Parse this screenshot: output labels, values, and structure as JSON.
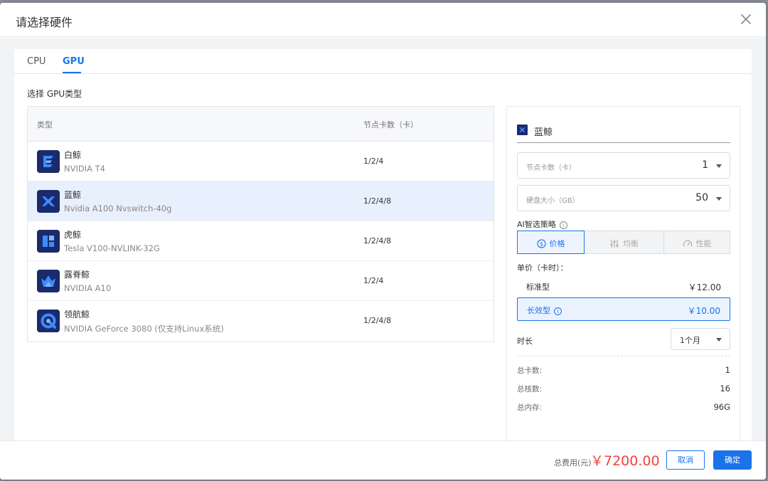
{
  "dialog": {
    "title": "请选择硬件",
    "tabs": [
      {
        "label": "CPU",
        "active": false
      },
      {
        "label": "GPU",
        "active": true
      }
    ],
    "section_title": "选择 GPU类型"
  },
  "gpu_table": {
    "headers": {
      "type": "类型",
      "cards": "节点卡数（卡）"
    },
    "rows": [
      {
        "name": "白鲸",
        "model": "NVIDIA T4",
        "cards": "1/2/4",
        "icon": "beluga-white-icon",
        "selected": false
      },
      {
        "name": "蓝鲸",
        "model": "Nvidia A100 Nvswitch-40g",
        "cards": "1/2/4/8",
        "icon": "blue-whale-icon",
        "selected": true
      },
      {
        "name": "虎鲸",
        "model": "Tesla V100-NVLINK-32G",
        "cards": "1/2/4/8",
        "icon": "orca-icon",
        "selected": false
      },
      {
        "name": "露脊鲸",
        "model": "NVIDIA A10",
        "cards": "1/2/4",
        "icon": "right-whale-icon",
        "selected": false
      },
      {
        "name": "领航鲸",
        "model": "NVIDIA GeForce 3080 (仅支持Linux系统)",
        "cards": "1/2/4/8",
        "icon": "pilot-whale-icon",
        "selected": false
      }
    ]
  },
  "config_panel": {
    "selected_name": "蓝鲸",
    "node_cards": {
      "label": "节点卡数（卡）",
      "value": "1"
    },
    "disk_size": {
      "label": "硬盘大小（GB）",
      "value": "50"
    },
    "ai_strategy": {
      "label": "AI智选策略",
      "options": [
        {
          "label": "价格",
          "icon": "dollar-circle-icon",
          "active": true
        },
        {
          "label": "均衡",
          "icon": "sliders-icon",
          "active": false
        },
        {
          "label": "性能",
          "icon": "speedometer-icon",
          "active": false
        }
      ]
    },
    "unit_price_label": "单价（卡时）：",
    "prices": [
      {
        "name": "标准型",
        "value": "￥12.00",
        "selected": false
      },
      {
        "name": "长效型",
        "value": "￥10.00",
        "selected": true
      }
    ],
    "duration": {
      "label": "时长",
      "value": "1个月"
    },
    "summary": [
      {
        "key": "总卡数:",
        "value": "1"
      },
      {
        "key": "总核数:",
        "value": "16"
      },
      {
        "key": "总内存:",
        "value": "96G"
      }
    ]
  },
  "footer": {
    "total_label": "总费用(元)",
    "total_value": "￥7200.00",
    "cancel_label": "取消",
    "confirm_label": "确定"
  },
  "colors": {
    "accent": "#1a73e8",
    "price_red": "#f0443a",
    "selected_row_bg": "#e8f0fd",
    "icon_navy": "#1b2a6b"
  }
}
